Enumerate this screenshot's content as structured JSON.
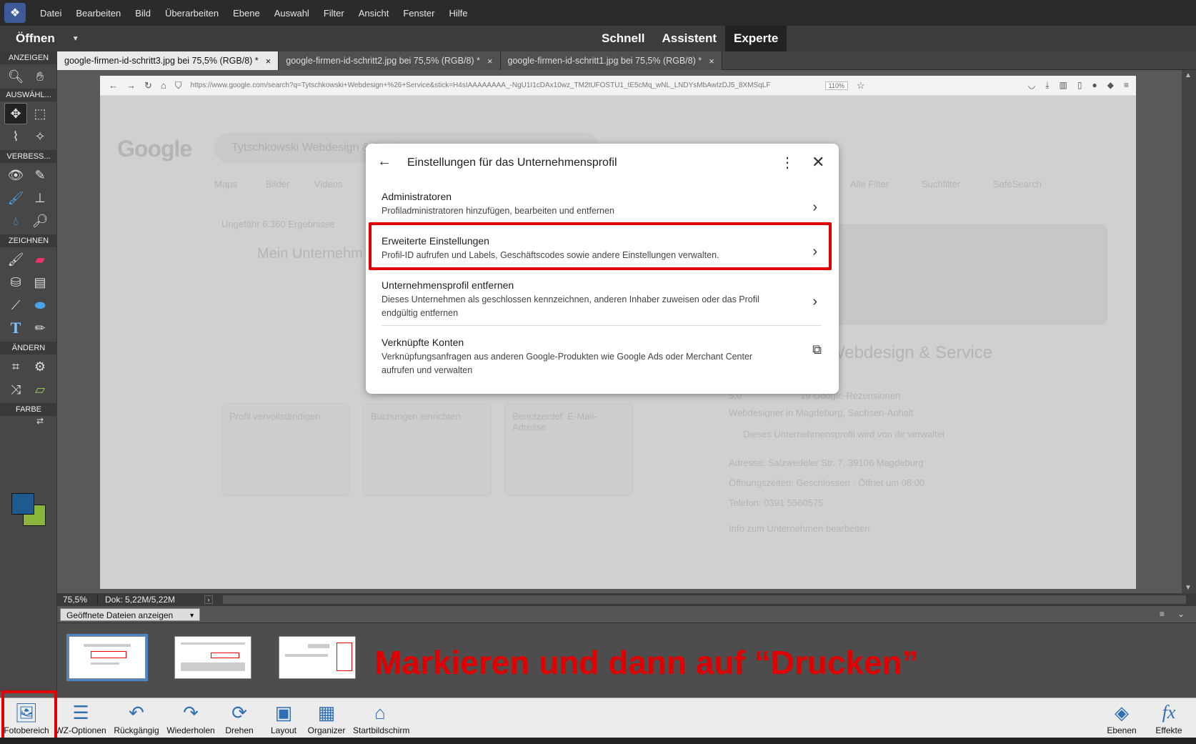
{
  "menu": [
    "Datei",
    "Bearbeiten",
    "Bild",
    "Überarbeiten",
    "Ebene",
    "Auswahl",
    "Filter",
    "Ansicht",
    "Fenster",
    "Hilfe"
  ],
  "modebar": {
    "open_label": "Öffnen",
    "modes": [
      "Schnell",
      "Assistent",
      "Experte"
    ],
    "active_mode": "Experte"
  },
  "toolbox": {
    "sections": [
      "ANZEIGEN",
      "AUSWÄHL...",
      "VERBESS...",
      "ZEICHNEN",
      "ÄNDERN",
      "FARBE"
    ],
    "colors": {
      "foreground": "#1f5a8f",
      "background": "#8ab43a"
    }
  },
  "doc_tabs": [
    {
      "label": "google-firmen-id-schritt3.jpg bei 75,5% (RGB/8) *",
      "close": "×"
    },
    {
      "label": "google-firmen-id-schritt2.jpg bei 75,5% (RGB/8) *",
      "close": "×"
    },
    {
      "label": "google-firmen-id-schritt1.jpg bei 75,5% (RGB/8) *",
      "close": "×"
    }
  ],
  "browser": {
    "url": "https://www.google.com/search?q=Tytschkowski+Webdesign+%26+Service&stick=H4sIAAAAAAAA_-NgU1I1cDAx10wz_TM2tUFOSTU1_tE5cMq_wNL_LNDYsMbAwIzDJ5_8XMSqLF",
    "zoom": "110%"
  },
  "google": {
    "logo": "Google",
    "query": "Tytschkowski Webdesign & Service",
    "tabs": [
      "Maps",
      "Bilder",
      "Videos"
    ],
    "filters": [
      "Alle Filter",
      "Suchfilter",
      "SafeSearch"
    ],
    "results_count": "Ungefähr 6.360 Ergebnisse",
    "biz_title": "Mein Unternehm",
    "kp_title": "Webdesign & Service",
    "kp_rating": "5,0",
    "kp_reviews": "19 Google-Rezensionen",
    "kp_category": "Webdesigner in Magdeburg, Sachsen-Anhalt",
    "kp_managed": "Dieses Unternehmensprofil wird von dir verwaltet",
    "kp_address": "Adresse: Salzwedeler Str. 7, 39106 Magdeburg",
    "kp_hours": "Öffnungszeiten: Geschlossen · Öffnet um 08:00",
    "kp_phone": "Telefon: 0391 5560575",
    "kp_edit": "Info zum Unternehmen bearbeiten",
    "card1_title": "Profil vervollständigen",
    "card2_title": "Buchungen einrichten",
    "card3_title": "Benutzerdef. E-Mail-Adresse"
  },
  "dialog": {
    "title": "Einstellungen für das Unternehmensprofil",
    "rows": [
      {
        "title": "Administratoren",
        "sub": "Profiladministratoren hinzufügen, bearbeiten und entfernen"
      },
      {
        "title": "Erweiterte Einstellungen",
        "sub": "Profil-ID aufrufen und Labels, Geschäftscodes sowie andere Einstellungen verwalten."
      },
      {
        "title": "Unternehmensprofil entfernen",
        "sub": "Dieses Unternehmen als geschlossen kennzeichnen, anderen Inhaber zuweisen oder das Profil endgültig entfernen"
      },
      {
        "title": "Verknüpfte Konten",
        "sub": "Verknüpfungsanfragen aus anderen Google-Produkten wie Google Ads oder Merchant Center aufrufen und verwalten"
      }
    ]
  },
  "status": {
    "zoom": "75,5%",
    "doc": "Dok: 5,22M/5,22M"
  },
  "bin": {
    "select_label": "Geöffnete Dateien anzeigen"
  },
  "annotation": "Markieren und dann auf “Drucken”",
  "bottom": [
    {
      "label": "Fotobereich",
      "icon": "photo-bin-icon"
    },
    {
      "label": "WZ-Optionen",
      "icon": "tool-options-icon"
    },
    {
      "label": "Rückgängig",
      "icon": "undo-icon"
    },
    {
      "label": "Wiederholen",
      "icon": "redo-icon"
    },
    {
      "label": "Drehen",
      "icon": "rotate-icon"
    },
    {
      "label": "Layout",
      "icon": "layout-icon"
    },
    {
      "label": "Organizer",
      "icon": "organizer-icon"
    },
    {
      "label": "Startbildschirm",
      "icon": "home-icon"
    },
    {
      "label": "Ebenen",
      "icon": "layers-icon"
    },
    {
      "label": "Effekte",
      "icon": "fx-icon"
    }
  ]
}
